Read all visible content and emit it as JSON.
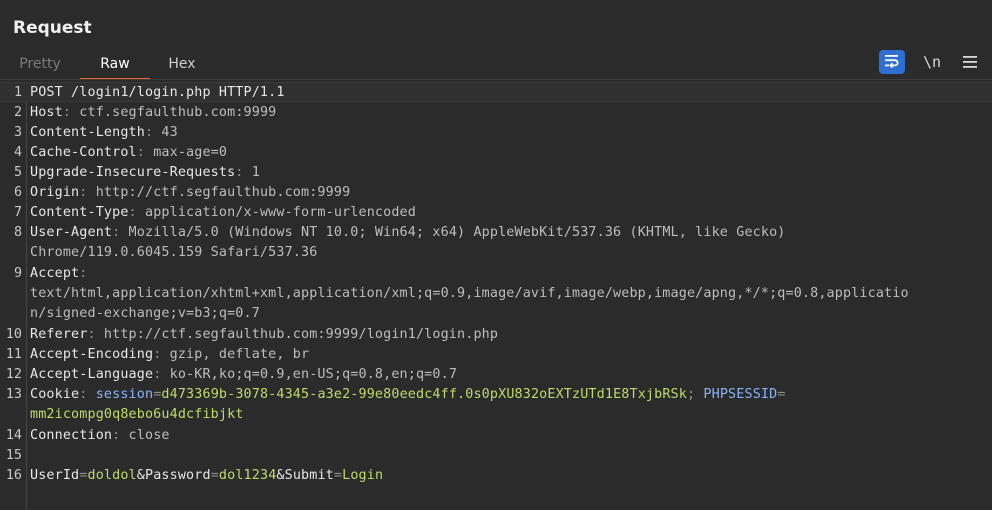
{
  "panel": {
    "title": "Request"
  },
  "tabs": [
    {
      "label": "Pretty"
    },
    {
      "label": "Raw"
    },
    {
      "label": "Hex"
    }
  ],
  "toolbar": {
    "newline_label": "\\n"
  },
  "lines": [
    {
      "n": "1",
      "text": "POST /login1/login.php HTTP/1.1"
    },
    {
      "n": "2",
      "key": "Host",
      "sep": ":",
      "val": " ctf.segfaulthub.com:9999"
    },
    {
      "n": "3",
      "key": "Content-Length",
      "sep": ":",
      "val": " 43"
    },
    {
      "n": "4",
      "key": "Cache-Control",
      "sep": ":",
      "val": " max-age=0"
    },
    {
      "n": "5",
      "key": "Upgrade-Insecure-Requests",
      "sep": ":",
      "val": " 1"
    },
    {
      "n": "6",
      "key": "Origin",
      "sep": ":",
      "val": " http://ctf.segfaulthub.com:9999"
    },
    {
      "n": "7",
      "key": "Content-Type",
      "sep": ":",
      "val": " application/x-www-form-urlencoded"
    },
    {
      "n": "8",
      "key": "User-Agent",
      "sep": ":",
      "val": " Mozilla/5.0 (Windows NT 10.0; Win64; x64) AppleWebKit/537.36 (KHTML, like Gecko)",
      "cont": "Chrome/119.0.6045.159 Safari/537.36"
    },
    {
      "n": "9",
      "key": "Accept",
      "sep": ":",
      "cont": "text/html,application/xhtml+xml,application/xml;q=0.9,image/avif,image/webp,image/apng,*/*;q=0.8,applicatio",
      "cont2": "n/signed-exchange;v=b3;q=0.7"
    },
    {
      "n": "10",
      "key": "Referer",
      "sep": ":",
      "val": " http://ctf.segfaulthub.com:9999/login1/login.php"
    },
    {
      "n": "11",
      "key": "Accept-Encoding",
      "sep": ":",
      "val": " gzip, deflate, br"
    },
    {
      "n": "12",
      "key": "Accept-Language",
      "sep": ":",
      "val": " ko-KR,ko;q=0.9,en-US;q=0.8,en;q=0.7"
    },
    {
      "n": "13",
      "key": "Cookie",
      "sep": ":",
      "cookie1_name": " session",
      "cookie1_eq": "=",
      "cookie1_val": "d473369b-3078-4345-a3e2-99e80eedc4ff.0s0pXU832oEXTzUTd1E8TxjbRSk",
      "cookie_sep": "; ",
      "cookie2_name": "PHPSESSID",
      "cookie2_eq": "=",
      "cookie2_val": "mm2icompg0q8ebo6u4dcfibjkt"
    },
    {
      "n": "14",
      "key": "Connection",
      "sep": ":",
      "val": " close"
    },
    {
      "n": "15"
    },
    {
      "n": "16",
      "b1k": "UserId",
      "b1e": "=",
      "b1v": "doldol",
      "b2k": "&Password",
      "b2e": "=",
      "b2v": "dol1234",
      "b3k": "&Submit",
      "b3e": "=",
      "b3v": "Login"
    }
  ]
}
